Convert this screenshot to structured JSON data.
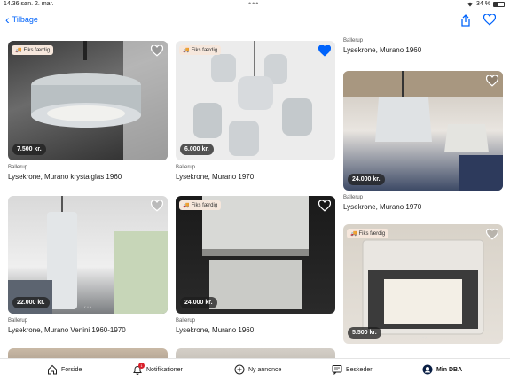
{
  "status": {
    "time": "14.36",
    "date": "søn. 2. mar.",
    "battery": "34 %"
  },
  "nav": {
    "back_label": "Tilbage"
  },
  "labels": {
    "badge": "Fiks færdig"
  },
  "listings": [
    {
      "location": "Ballerup",
      "title": "Lysekrone, Murano krystalglas 1960",
      "price": "7.500 kr.",
      "badge": true,
      "favorited": false
    },
    {
      "location": "Ballerup",
      "title": "Lysekrone, Murano Venini 1960-1970",
      "price": "22.000 kr.",
      "badge": false,
      "favorited": false
    },
    {
      "location": "Ballerup",
      "title": "Lysekrone, Murano 1970",
      "price": "6.000 kr.",
      "badge": true,
      "favorited": true
    },
    {
      "location": "Ballerup",
      "title": "Lysekrone, Murano 1960",
      "price": "24.000 kr.",
      "badge": true,
      "favorited": false
    },
    {
      "location": "Ballerup",
      "title": "Lysekrone, Murano 1960",
      "price": "",
      "badge": false,
      "favorited": false
    },
    {
      "location": "Ballerup",
      "title": "Lysekrone, Murano 1970",
      "price": "24.000 kr.",
      "badge": false,
      "favorited": false
    },
    {
      "location": "",
      "title": "",
      "price": "5.500 kr.",
      "badge": true,
      "favorited": false
    }
  ],
  "tabs": [
    {
      "label": "Forside",
      "icon": "home-icon"
    },
    {
      "label": "Notifikationer",
      "icon": "bell-icon",
      "count": "1"
    },
    {
      "label": "Ny annonce",
      "icon": "plus-circle-icon"
    },
    {
      "label": "Beskeder",
      "icon": "chat-icon"
    },
    {
      "label": "Min DBA",
      "icon": "profile-icon"
    }
  ],
  "colors": {
    "accent": "#0063fb",
    "badge_bg": "#f6e7dc",
    "notification": "#d9202b",
    "favorite": "#0063fb"
  }
}
